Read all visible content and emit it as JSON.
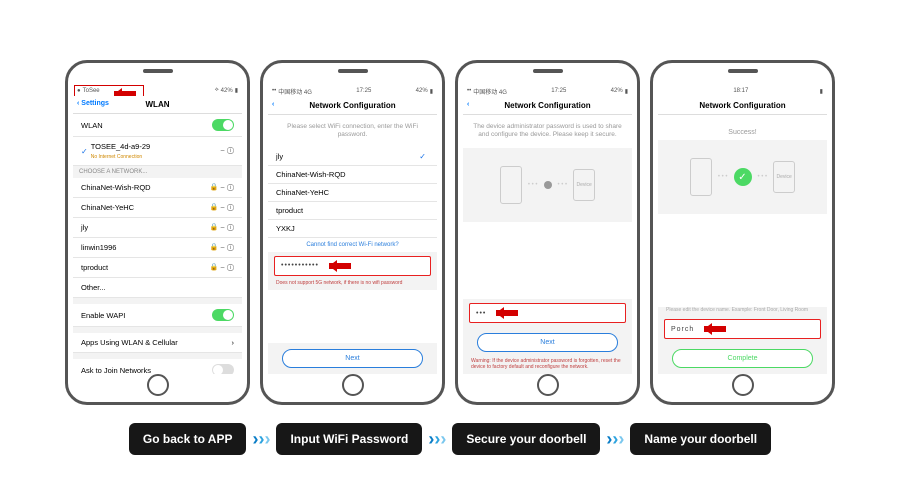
{
  "captions": [
    "Go back to APP",
    "Input WiFi Password",
    "Secure your doorbell",
    "Name your doorbell"
  ],
  "screen1": {
    "carrier": "ToSee",
    "batt": "42%",
    "back": "Settings",
    "title": "WLAN",
    "wlan_label": "WLAN",
    "connected": {
      "ssid": "TOSEE_4d-a9-29",
      "sub": "No Internet Connection"
    },
    "choose": "CHOOSE A NETWORK...",
    "nets": [
      "ChinaNet-Wish-RQD",
      "ChinaNet-YeHC",
      "jly",
      "linwin1996",
      "tproduct",
      "Other..."
    ],
    "wapi": "Enable WAPI",
    "apps": "Apps Using WLAN & Cellular",
    "ask": "Ask to Join Networks"
  },
  "screen2": {
    "carrier": "中国移动 4G",
    "time": "17:25",
    "batt": "42%",
    "title": "Network Configuration",
    "instr": "Please select WiFi connection, enter the WiFi password.",
    "nets": [
      "jly",
      "ChinaNet-Wish-RQD",
      "ChinaNet-YeHC",
      "tproduct",
      "YXKJ"
    ],
    "help": "Cannot find correct Wi-Fi network?",
    "pwd": "•••••••••••",
    "warn": "Does not support 5G network, if there is no wifi password",
    "next": "Next"
  },
  "screen3": {
    "carrier": "中国移动 4G",
    "time": "17:25",
    "batt": "42%",
    "title": "Network Configuration",
    "instr": "The device administrator password is used to share and configure the device. Please keep it secure.",
    "device_lbl": "Device",
    "pwd": "•••",
    "next": "Next",
    "warn": "Warning: If the device administrator password is forgotten, reset the device to factory default and reconfigure the network."
  },
  "screen4": {
    "carrier": "",
    "time": "18:17",
    "batt": "",
    "title": "Network Configuration",
    "success": "Success!",
    "device_lbl": "Device",
    "hint": "Please edit the device name. Example: Front Door, Living Room",
    "value": "Porch",
    "complete": "Complete"
  }
}
